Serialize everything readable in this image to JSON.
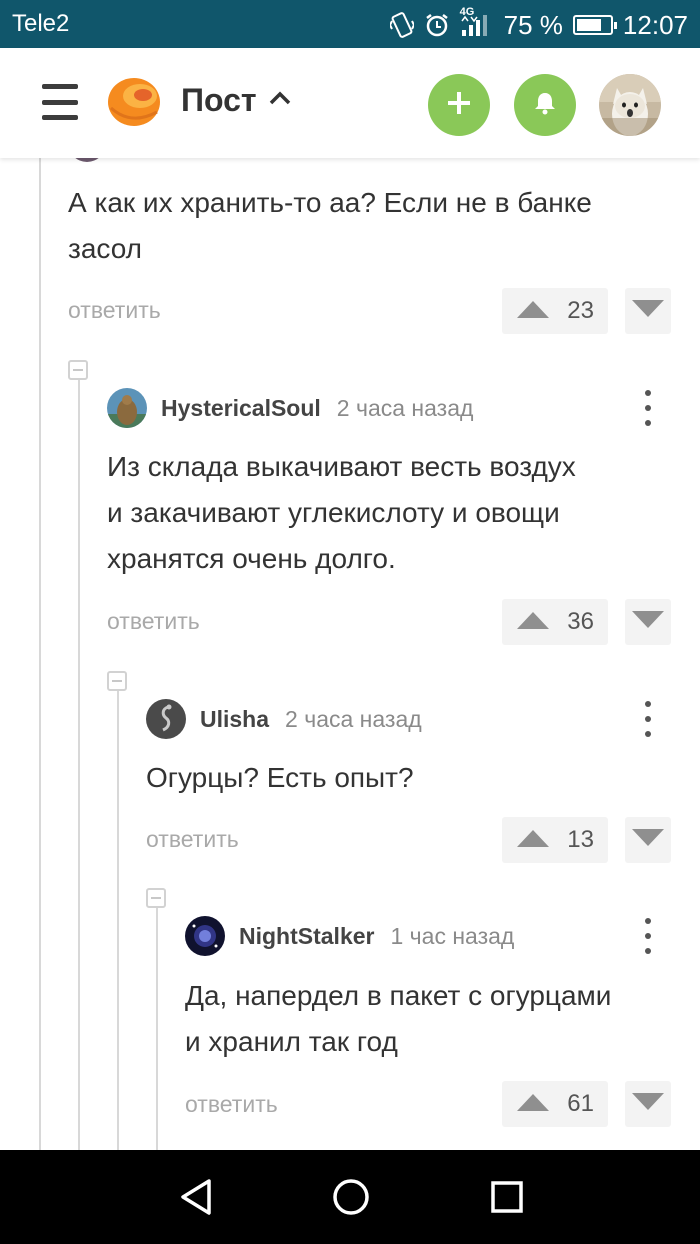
{
  "status_bar": {
    "carrier": "Tele2",
    "network": "4G",
    "battery_text": "75 %",
    "battery_level": 0.75,
    "time": "12:07",
    "icons": [
      "vibrate-icon",
      "alarm-icon",
      "signal-icon",
      "battery-icon"
    ]
  },
  "header": {
    "title": "Пост",
    "menu_icon": "hamburger-icon",
    "logo": "pikabu-logo",
    "add_icon": "plus-icon",
    "bell_icon": "bell-icon",
    "accent_color": "#8ac858"
  },
  "comments": [
    {
      "author": "",
      "time": "",
      "text_lines": [
        "А как их хранить-то аа? Если не в банке",
        "засол"
      ],
      "reply_label": "ответить",
      "votes": "23"
    },
    {
      "author": "HystericalSoul",
      "time": "2 часа назад",
      "text_lines": [
        "Из склада выкачивают весть воздух",
        "и закачивают углекислоту и овощи",
        "хранятся очень долго."
      ],
      "reply_label": "ответить",
      "votes": "36"
    },
    {
      "author": "Ulisha",
      "time": "2 часа назад",
      "text_lines": [
        "Огурцы? Есть опыт?"
      ],
      "reply_label": "ответить",
      "votes": "13"
    },
    {
      "author": "NightStalker",
      "time": "1 час назад",
      "text_lines": [
        "Да, напердел в пакет с огурцами",
        "и хранил так год"
      ],
      "reply_label": "ответить",
      "votes": "61"
    }
  ],
  "nav": {
    "back_icon": "back-triangle-icon",
    "home_icon": "home-circle-icon",
    "recents_icon": "recents-square-icon"
  }
}
